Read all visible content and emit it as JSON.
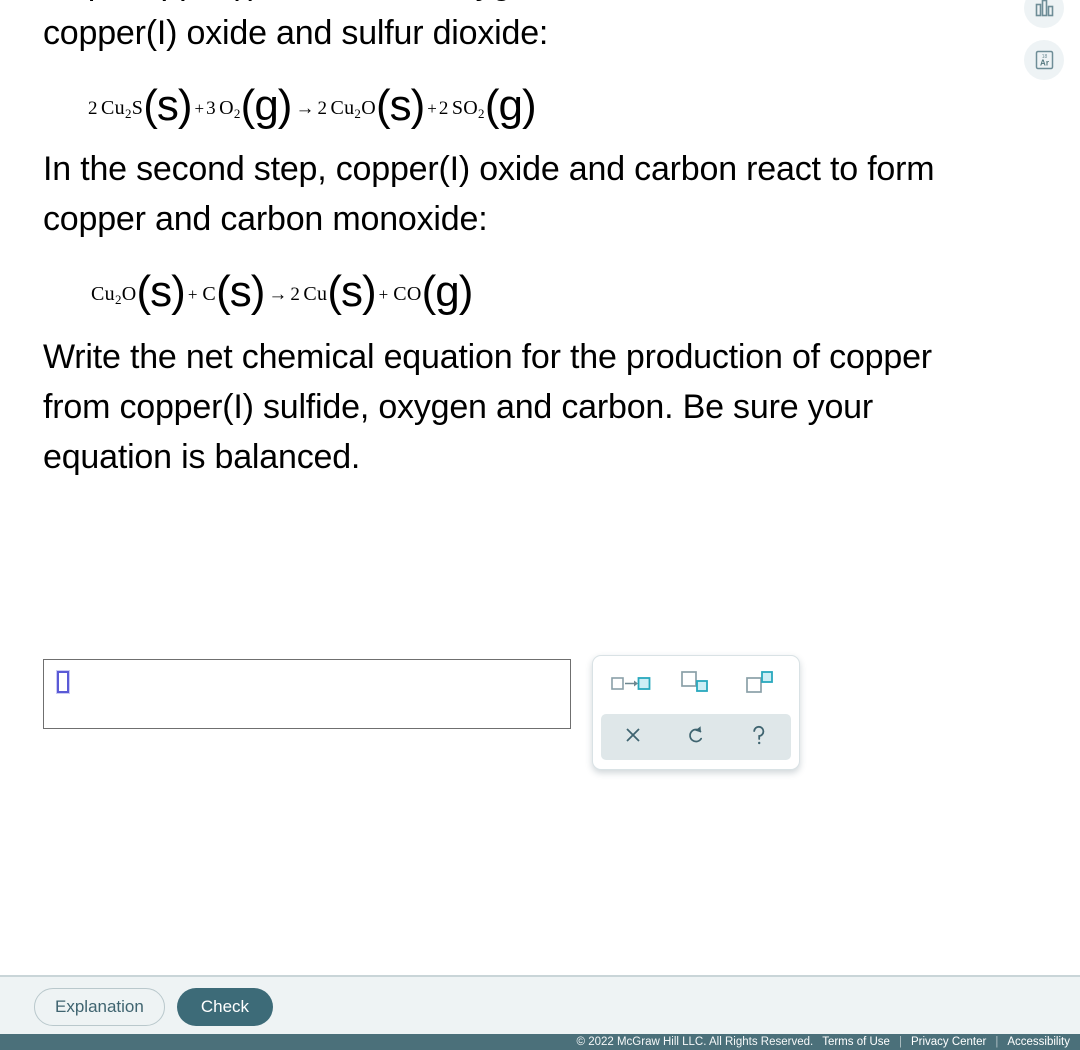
{
  "question": {
    "para1": "step, copper(I) sulfide and oxygen react to form\ncopper(I) oxide and sulfur dioxide:",
    "para2": "In the second step, copper(I) oxide and carbon react to form copper and carbon monoxide:",
    "para3": "Write the net chemical equation for the production of copper from copper(I) sulfide, oxygen and carbon. Be sure your equation is balanced."
  },
  "equation1": {
    "r1_coef": "2",
    "r1_formula": "Cu",
    "r1_sub": "2",
    "r1_tail": "S",
    "r1_state": "(s)",
    "plus1": "+",
    "r2_coef": "3",
    "r2_formula": "O",
    "r2_sub": "2",
    "r2_state": "(g)",
    "arrow": "→",
    "p1_coef": "2",
    "p1_formula": "Cu",
    "p1_sub": "2",
    "p1_tail": "O",
    "p1_state": "(s)",
    "plus2": "+",
    "p2_coef": "2",
    "p2_formula": "SO",
    "p2_sub": "2",
    "p2_state": "(g)"
  },
  "equation2": {
    "r1_coef": "",
    "r1_formula": "Cu",
    "r1_sub": "2",
    "r1_tail": "O",
    "r1_state": "(s)",
    "plus1": "+",
    "r2_coef": "",
    "r2_formula": "C",
    "r2_sub": "",
    "r2_state": "(s)",
    "arrow": "→",
    "p1_coef": "2",
    "p1_formula": "Cu",
    "p1_sub": "",
    "p1_tail": "",
    "p1_state": "(s)",
    "plus2": "+",
    "p2_coef": "",
    "p2_formula": "CO",
    "p2_sub": "",
    "p2_state": "(g)"
  },
  "answer": {
    "value": "",
    "placeholder_symbol": "empty-slot"
  },
  "palette": {
    "buttons": [
      {
        "name": "reaction-arrow-icon",
        "label": "reaction arrow"
      },
      {
        "name": "subscript-icon",
        "label": "subscript"
      },
      {
        "name": "superscript-icon",
        "label": "superscript"
      }
    ],
    "actions": [
      {
        "name": "delete-icon",
        "glyph": "×",
        "label": "delete"
      },
      {
        "name": "undo-icon",
        "glyph": "↺",
        "label": "undo"
      },
      {
        "name": "help-icon",
        "glyph": "?",
        "label": "help"
      }
    ]
  },
  "tool_rail": [
    {
      "name": "bar-chart-icon",
      "label": "data tools"
    },
    {
      "name": "periodic-table-icon",
      "label": "Ar",
      "symbol": "Ar",
      "atomic_number": "18"
    }
  ],
  "actions": {
    "explanation_label": "Explanation",
    "check_label": "Check"
  },
  "footer": {
    "copyright": "© 2022 McGraw Hill LLC. All Rights Reserved.",
    "links": [
      "Terms of Use",
      "Privacy Center",
      "Accessibility"
    ],
    "separator": "|"
  },
  "colors": {
    "check_button": "#3d6b78",
    "footer_bar": "#4b707a",
    "action_bar": "#eef3f4",
    "palette_accent": "#28a8bd",
    "placeholder_outline": "#5a5ad6"
  }
}
